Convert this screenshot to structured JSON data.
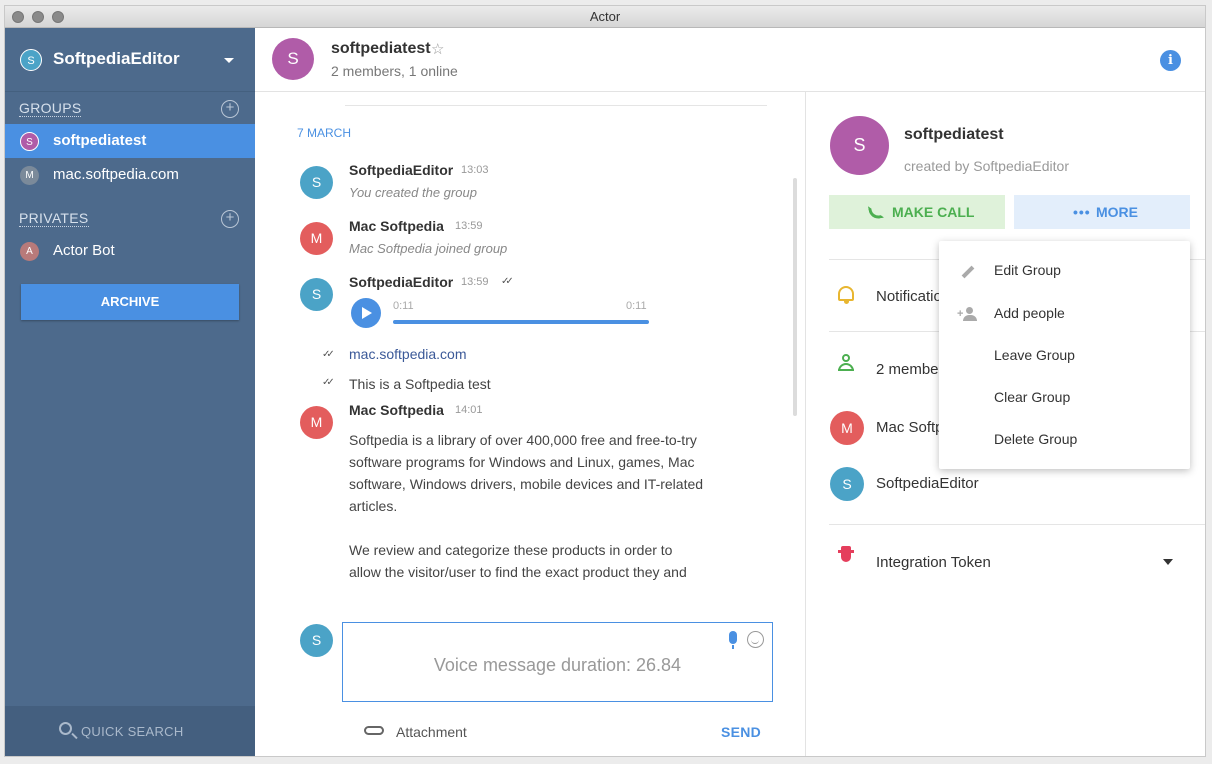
{
  "window": {
    "title": "Actor"
  },
  "sidebar": {
    "account": {
      "initial": "S",
      "name": "SoftpediaEditor"
    },
    "groups_header": "GROUPS",
    "groups": [
      {
        "initial": "S",
        "name": "softpediatest",
        "color": "#b05ca8",
        "active": true
      },
      {
        "initial": "M",
        "name": "mac.softpedia.com",
        "color": "#7b8a9a",
        "active": false
      }
    ],
    "privates_header": "PRIVATES",
    "privates": [
      {
        "initial": "A",
        "name": "Actor Bot",
        "color": "#b87a7a"
      }
    ],
    "archive_label": "ARCHIVE",
    "quick_search_label": "QUICK SEARCH"
  },
  "header": {
    "initial": "S",
    "name": "softpediatest",
    "subtitle": "2 members, 1 online"
  },
  "chat": {
    "date": "7 MARCH",
    "messages": [
      {
        "initial": "S",
        "sender": "SoftpediaEditor",
        "time": "13:03",
        "text": "You created the group"
      },
      {
        "initial": "M",
        "sender": "Mac Softpedia",
        "time": "13:59",
        "text": "Mac Softpedia joined group"
      },
      {
        "initial": "S",
        "sender": "SoftpediaEditor",
        "time": "13:59",
        "audio_elapsed": "0:11",
        "audio_total": "0:11"
      },
      {
        "text": "mac.softpedia.com"
      },
      {
        "text": "This is a Softpedia test"
      },
      {
        "initial": "M",
        "sender": "Mac Softpedia",
        "time": "14:01",
        "lines": [
          "Softpedia is a library of over 400,000 free and free-to-try",
          "software programs for Windows and Linux, games, Mac",
          "software, Windows drivers, mobile devices and IT-related",
          "articles.",
          "",
          "We review and categorize these products in order to",
          "allow the visitor/user to find the exact product they and"
        ]
      }
    ],
    "composer": {
      "initial": "S",
      "placeholder": "Voice message duration: 26.84",
      "attachment_label": "Attachment",
      "send_label": "SEND"
    }
  },
  "group_panel": {
    "initial": "S",
    "name": "softpediatest",
    "created_by": "created by SoftpediaEditor",
    "make_call_label": "MAKE CALL",
    "more_label": "MORE",
    "notifications_label": "Notificatio",
    "members_label": "2 member",
    "members": [
      {
        "initial": "M",
        "name": "Mac Softp",
        "color": "#e35d5d"
      },
      {
        "initial": "S",
        "name": "SoftpediaEditor",
        "color": "#4ba3c7"
      }
    ],
    "integration_label": "Integration Token"
  },
  "more_menu": {
    "items": [
      "Edit Group",
      "Add people",
      "Leave Group",
      "Clear Group",
      "Delete Group"
    ]
  },
  "colors": {
    "sidebar_bg": "#4d6a8c",
    "accent": "#4a90e2",
    "group_avatar": "#b05ca8",
    "user_s": "#4ba3c7",
    "user_m": "#e35d5d",
    "call_green": "#4caf50"
  }
}
